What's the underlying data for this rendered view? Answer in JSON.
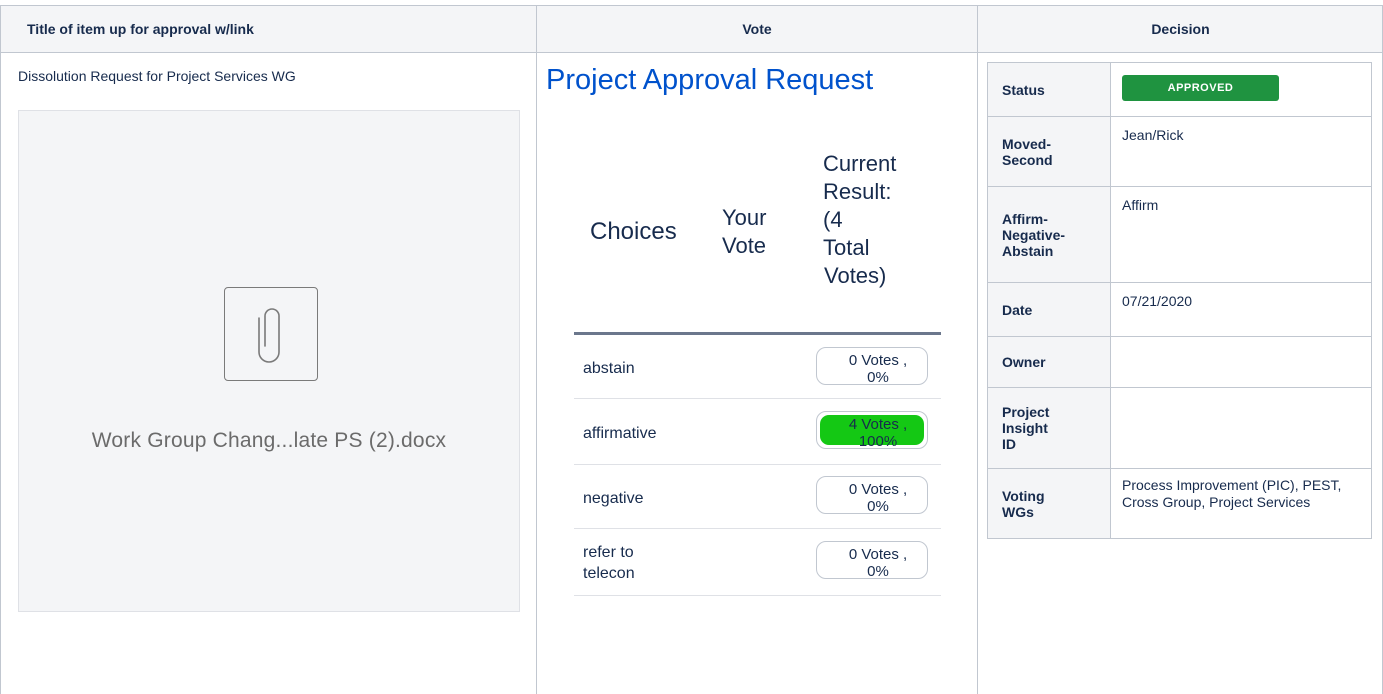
{
  "headers": {
    "title_col": "Title of item up for approval w/link",
    "vote_col": "Vote",
    "decision_col": "Decision"
  },
  "item": {
    "title": "Dissolution Request for Project Services WG",
    "attachment_name": "Work Group Chang...late PS (2).docx",
    "attachment_icon": "paperclip-icon"
  },
  "vote": {
    "title": "Project Approval Request",
    "col_choices": "Choices",
    "col_your_vote_line1": "Your",
    "col_your_vote_line2": "Vote",
    "col_result_lines": [
      "Current",
      "Result:",
      "(4",
      "Total",
      "Votes)"
    ],
    "rows": [
      {
        "choice": "abstain",
        "votes_line1": "0 Votes ,",
        "votes_line2": "0%",
        "percent": 0
      },
      {
        "choice": "affirmative",
        "votes_line1": "4 Votes ,",
        "votes_line2": "100%",
        "percent": 100
      },
      {
        "choice": "negative",
        "votes_line1": "0 Votes ,",
        "votes_line2": "0%",
        "percent": 0
      },
      {
        "choice_line1": "refer to",
        "choice_line2": "telecon",
        "votes_line1": "0 Votes ,",
        "votes_line2": "0%",
        "percent": 0
      }
    ],
    "fill_color": "#14c814"
  },
  "decision": {
    "status_label": "Status",
    "status_value": "APPROVED",
    "status_color": "#1f9340",
    "moved_label_line1": "Moved-",
    "moved_label_line2": "Second",
    "moved_value": "Jean/Rick",
    "afn_label_line1": "Affirm-",
    "afn_label_line2": "Negative-",
    "afn_label_line3": "Abstain",
    "afn_value": "Affirm",
    "date_label": "Date",
    "date_value": "07/21/2020",
    "owner_label": "Owner",
    "owner_value": "",
    "pi_label_line1": "Project",
    "pi_label_line2": "Insight",
    "pi_label_line3": "ID",
    "pi_value": "",
    "wgs_label_line1": "Voting",
    "wgs_label_line2": "WGs",
    "wgs_value": "Process Improvement (PIC), PEST, Cross Group, Project Services"
  }
}
